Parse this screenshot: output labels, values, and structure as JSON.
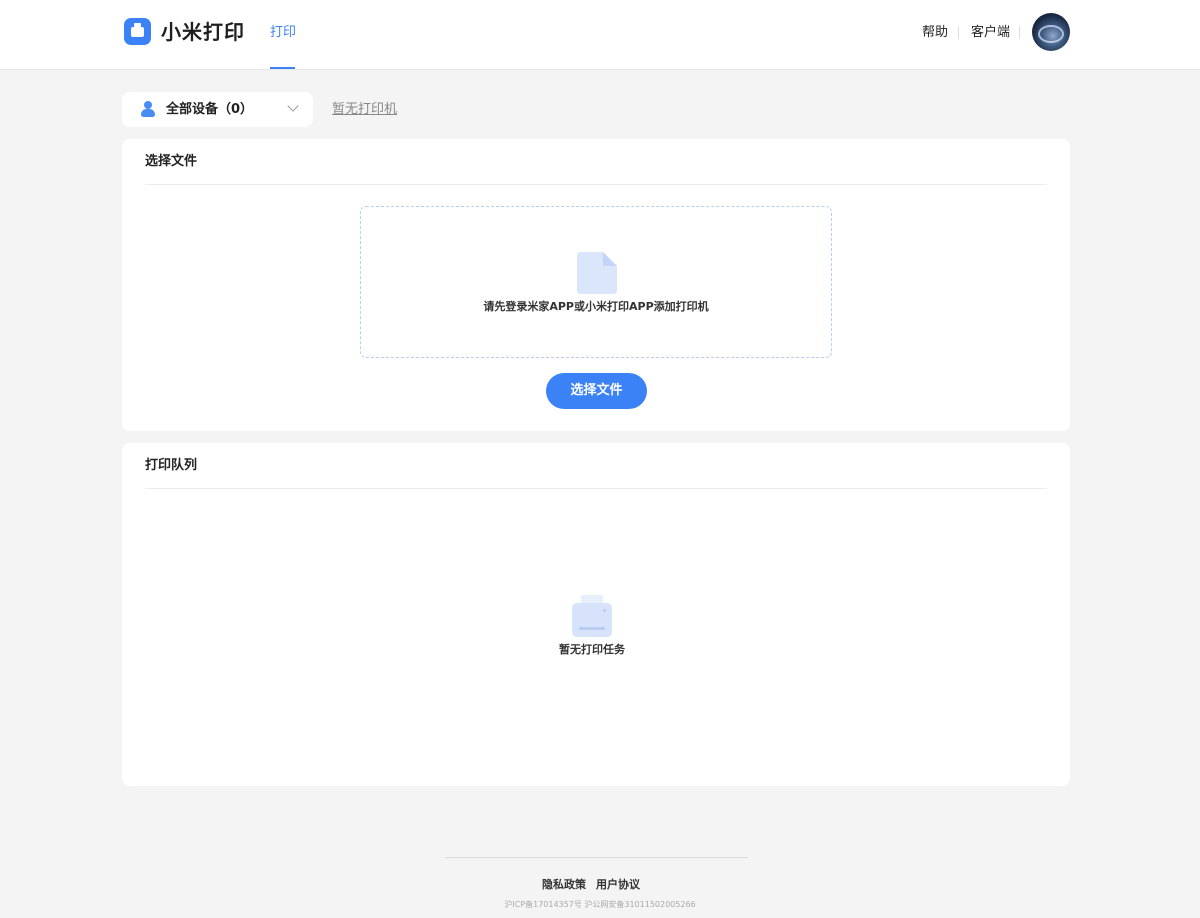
{
  "header": {
    "brand": "小米打印",
    "nav_tab": "打印",
    "help": "帮助",
    "client": "客户端",
    "accent": "#3b82f6"
  },
  "device_bar": {
    "selector_label": "全部设备（0）",
    "no_printer": "暂无打印机"
  },
  "file_card": {
    "title": "选择文件",
    "prompt": "请先登录米家APP或小米打印APP添加打印机",
    "button": "选择文件"
  },
  "queue_card": {
    "title": "打印队列",
    "empty": "暂无打印任务"
  },
  "footer": {
    "privacy": "隐私政策",
    "agreement": "用户协议",
    "icp": "沪ICP备17014357号 沪公网安备31011502005266"
  }
}
